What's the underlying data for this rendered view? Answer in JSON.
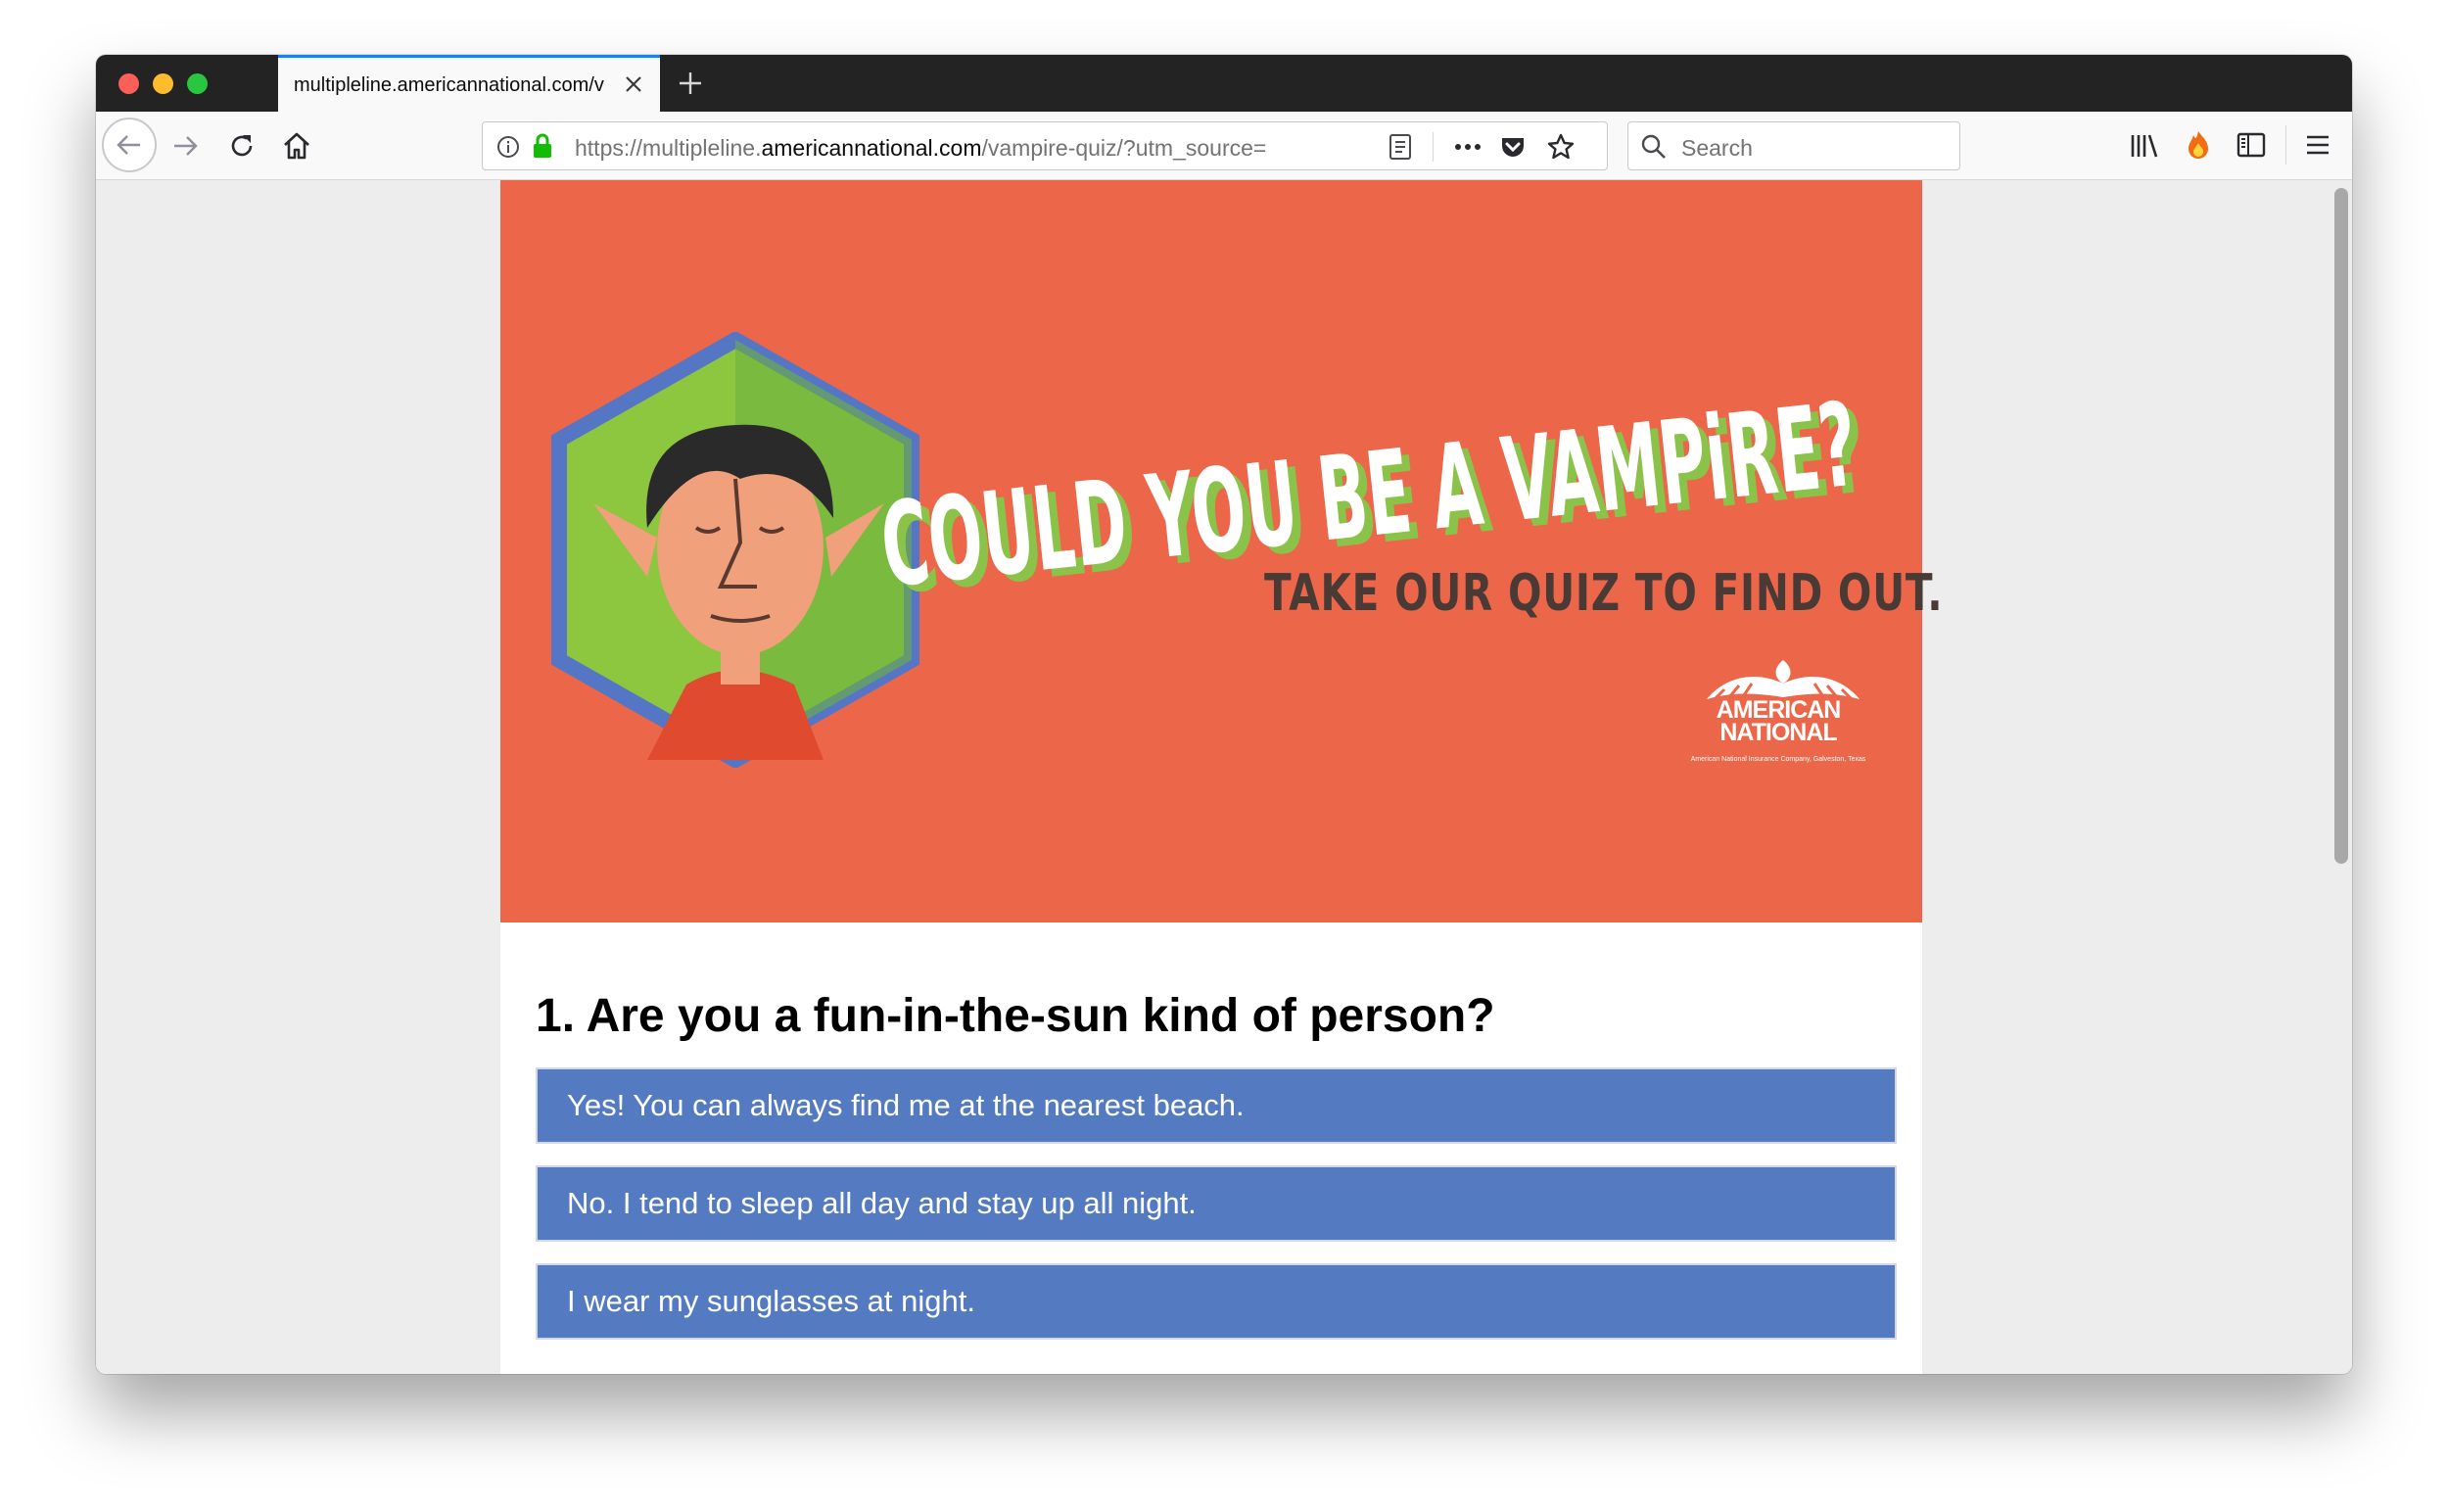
{
  "browser": {
    "tab_title": "multipleline.americannational.com/v",
    "url_prefix": "https://multipleline.",
    "url_host": "americannational.com",
    "url_path": "/vampire-quiz/?utm_source=",
    "search_placeholder": "Search"
  },
  "banner": {
    "title": "COULD YOU BE A VAMPiRE?",
    "subtitle": "TAKE OUR QUIZ TO FIND OUT.",
    "logo_line1": "AMERICAN",
    "logo_line2": "NATIONAL",
    "logo_fineprint": "American National Insurance Company, Galveston, Texas",
    "colors": {
      "background": "#ec6649",
      "title_fill": "#ffffff",
      "title_shadow": "#8bc34a"
    }
  },
  "quiz": {
    "question": "1. Are you a fun-in-the-sun kind of person?",
    "answers": [
      "Yes! You can always find me at the nearest beach.",
      "No. I tend to sleep all day and stay up all night.",
      "I wear my sunglasses at night."
    ],
    "answer_color": "#547bc1"
  }
}
